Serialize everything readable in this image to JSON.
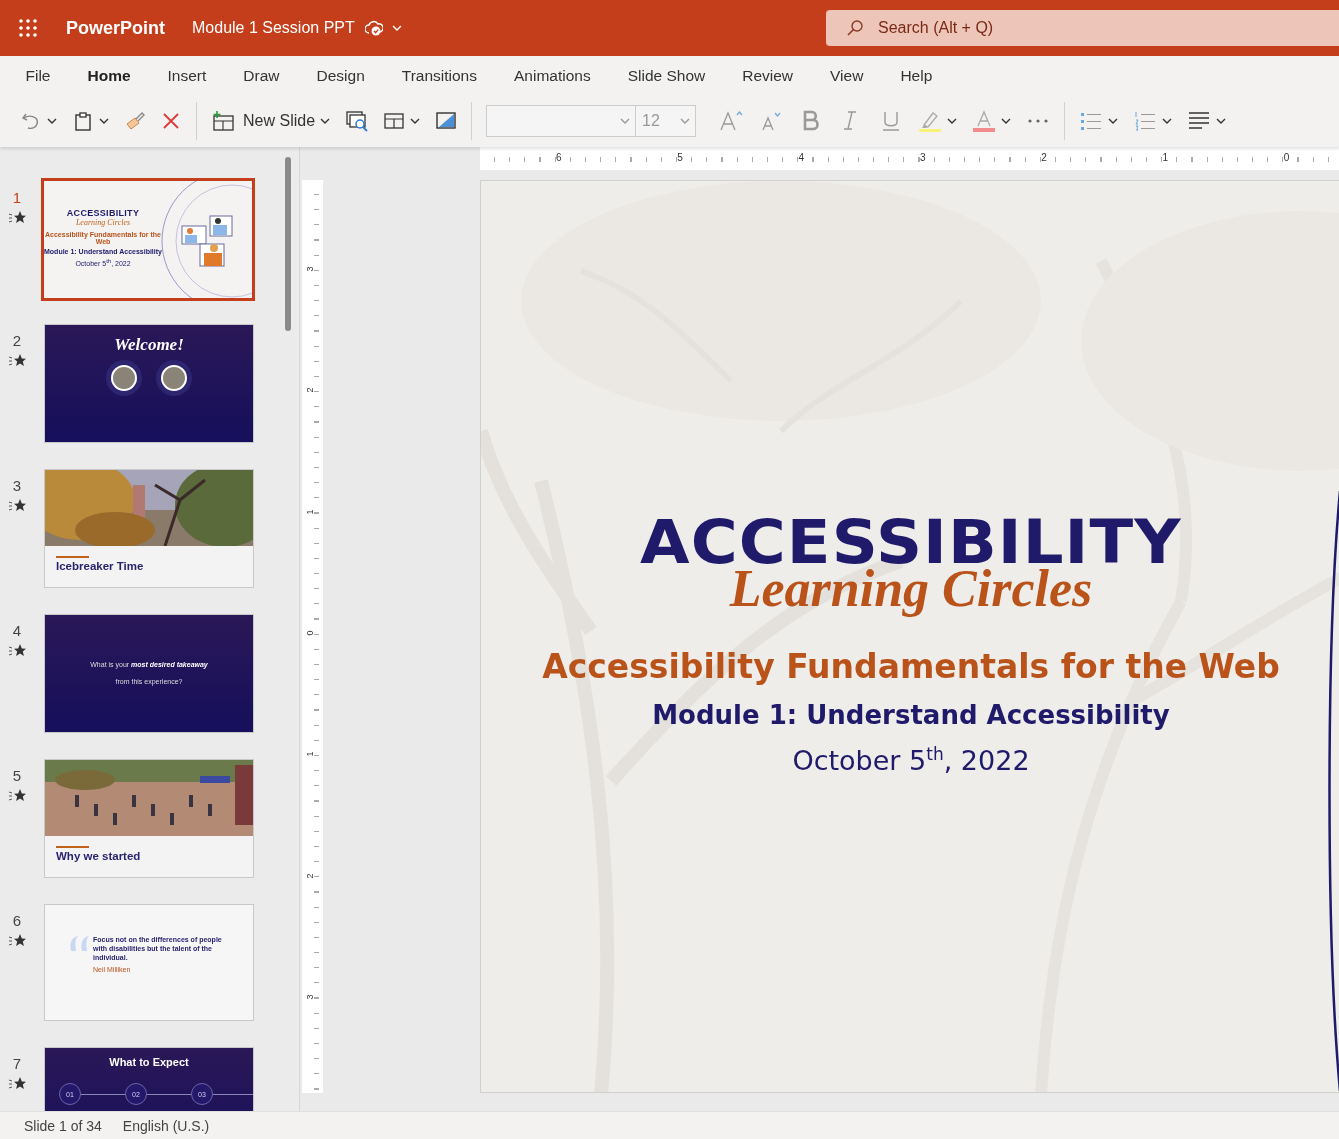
{
  "app": {
    "name": "PowerPoint",
    "document": "Module 1 Session PPT",
    "search": {
      "placeholder": "Search (Alt + Q)"
    }
  },
  "ribbon_tabs": [
    {
      "label": "File",
      "selected": false
    },
    {
      "label": "Home",
      "selected": true
    },
    {
      "label": "Insert",
      "selected": false
    },
    {
      "label": "Draw",
      "selected": false
    },
    {
      "label": "Design",
      "selected": false
    },
    {
      "label": "Transitions",
      "selected": false
    },
    {
      "label": "Animations",
      "selected": false
    },
    {
      "label": "Slide Show",
      "selected": false
    },
    {
      "label": "Review",
      "selected": false
    },
    {
      "label": "View",
      "selected": false
    },
    {
      "label": "Help",
      "selected": false
    }
  ],
  "toolbar": [
    {
      "kind": "undo"
    },
    {
      "kind": "paste"
    },
    {
      "kind": "painter"
    },
    {
      "kind": "delete"
    },
    {
      "kind": "separator"
    },
    {
      "kind": "new-slide",
      "label": "New Slide"
    },
    {
      "kind": "reuse"
    },
    {
      "kind": "layout"
    },
    {
      "kind": "background"
    },
    {
      "kind": "separator"
    },
    {
      "kind": "font-name"
    },
    {
      "kind": "font-size",
      "value": "12"
    },
    {
      "kind": "grow"
    },
    {
      "kind": "shrink"
    },
    {
      "kind": "bold"
    },
    {
      "kind": "italic"
    },
    {
      "kind": "underline"
    },
    {
      "kind": "highlight"
    },
    {
      "kind": "font-color"
    },
    {
      "kind": "more"
    },
    {
      "kind": "separator"
    },
    {
      "kind": "bullets"
    },
    {
      "kind": "numbering"
    },
    {
      "kind": "align"
    }
  ],
  "thumbnails": [
    {
      "number": "1",
      "selected": true,
      "kind": "title",
      "texts": [
        "ACCESSIBILITY",
        "Learning Circles",
        "Accessibility Fundamentals for the Web",
        "Module 1: Understand Accessibility",
        "October 5$^{th}$, 2022"
      ]
    },
    {
      "number": "2",
      "selected": false,
      "kind": "welcome",
      "title": "Welcome!"
    },
    {
      "number": "3",
      "selected": false,
      "kind": "section",
      "title": "Icebreaker Time"
    },
    {
      "number": "4",
      "selected": false,
      "kind": "question",
      "text": "What is your **most desired** **takeaway** from this experience?"
    },
    {
      "number": "5",
      "selected": false,
      "kind": "section",
      "title": "Why we started"
    },
    {
      "number": "6",
      "selected": false,
      "kind": "quote",
      "quote": "Focus not on the differences of people with disabilities but the talent of the individual.",
      "author": "Neil Milliken"
    },
    {
      "number": "7",
      "selected": false,
      "kind": "agenda",
      "title": "What to Expect",
      "steps": [
        "01",
        "02",
        "03"
      ]
    }
  ],
  "rulers": {
    "horizontal": [
      "6",
      "5",
      "4",
      "3",
      "2",
      "1",
      "0"
    ],
    "vertical": [
      "3",
      "2",
      "1",
      "0",
      "1",
      "2",
      "3"
    ]
  },
  "slide": {
    "heading": "ACCESSIBILITY",
    "script": "Learning Circles",
    "title": "Accessibility Fundamentals for the Web",
    "subtitle": "Module 1: Understand Accessibility",
    "date": "October 5$^{th}$, 2022"
  },
  "status_bar": {
    "slide": "Slide 1 of 34",
    "language": "English (U.S.)"
  }
}
